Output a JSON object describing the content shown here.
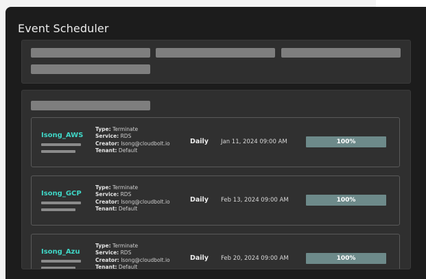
{
  "window": {
    "title": "Event Scheduler"
  },
  "events": [
    {
      "name": "Isong_AWS",
      "type_label": "Type:",
      "type": "Terminate",
      "service_label": "Service:",
      "service": "RDS",
      "creator_label": "Creator:",
      "creator": "Isong@cloudbolt.io",
      "tenant_label": "Tenant:",
      "tenant": "Default",
      "frequency": "Daily",
      "datetime": "Jan 11, 2024 09:00 AM",
      "progress_label": "100%",
      "progress": 1.0
    },
    {
      "name": "Isong_GCP",
      "type_label": "Type:",
      "type": "Terminate",
      "service_label": "Service:",
      "service": "RDS",
      "creator_label": "Creator:",
      "creator": "Isong@cloudbolt.io",
      "tenant_label": "Tenant:",
      "tenant": "Default",
      "frequency": "Daily",
      "datetime": "Feb 13, 2024 09:00 AM",
      "progress_label": "100%",
      "progress": 1.0
    },
    {
      "name": "Isong_Azu",
      "type_label": "Type:",
      "type": "Terminate",
      "service_label": "Service:",
      "service": "RDS",
      "creator_label": "Creator:",
      "creator": "Isong@cloudbolt.io",
      "tenant_label": "Tenant:",
      "tenant": "Default",
      "frequency": "Daily",
      "datetime": "Feb 20, 2024 09:00 AM",
      "progress_label": "100%",
      "progress": 1.0
    }
  ],
  "colors": {
    "accent": "#3fd6c6",
    "progress_fill": "#6d8a8a",
    "window_bg": "#1c1c1c",
    "panel_bg": "#2f2f2f"
  }
}
